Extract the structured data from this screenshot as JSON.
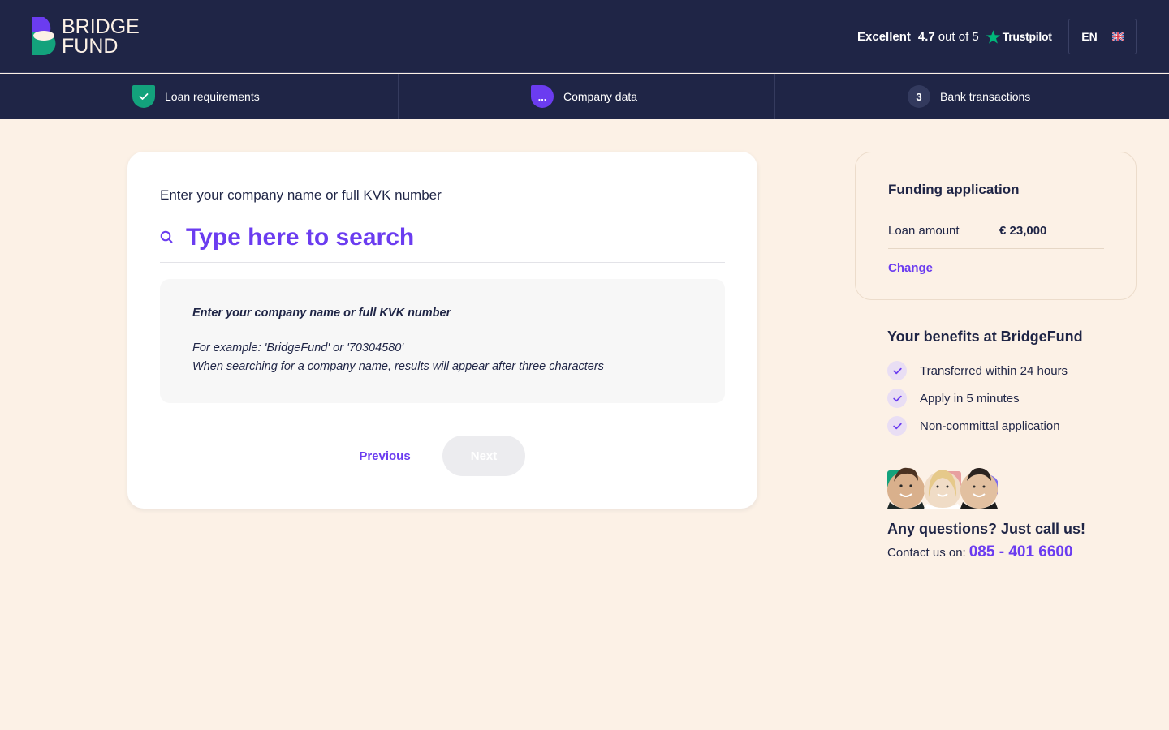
{
  "header": {
    "logo": {
      "line1": "BRIDGE",
      "line2": "FUND"
    },
    "trustpilot": {
      "rating_word": "Excellent",
      "score": "4.7",
      "out_of": "out of 5",
      "brand": "Trustpilot"
    },
    "language": {
      "code": "EN",
      "flag": "uk-flag-icon"
    }
  },
  "steps": [
    {
      "label": "Loan requirements",
      "state": "done",
      "badge": ""
    },
    {
      "label": "Company data",
      "state": "active",
      "badge": "..."
    },
    {
      "label": "Bank transactions",
      "state": "todo",
      "badge": "3"
    }
  ],
  "search": {
    "label": "Enter your company name or full KVK number",
    "placeholder": "Type here to search",
    "value": ""
  },
  "hint": {
    "title": "Enter your company name or full KVK number",
    "line1": "For example: 'BridgeFund' or '70304580'",
    "line2": "When searching for a company name, results will appear after three characters"
  },
  "actions": {
    "previous": "Previous",
    "next": "Next"
  },
  "funding": {
    "title": "Funding application",
    "loan_label": "Loan amount",
    "loan_value": "€ 23,000",
    "change": "Change"
  },
  "benefits": {
    "title": "Your benefits at BridgeFund",
    "items": [
      "Transferred within 24 hours",
      "Apply in 5 minutes",
      "Non-committal application"
    ]
  },
  "contact": {
    "title": "Any questions? Just call us!",
    "prefix": "Contact us on:",
    "phone": "085 - 401 6600"
  },
  "colors": {
    "navy": "#1f2546",
    "purple": "#6b3cf0",
    "green": "#13a27c",
    "cream": "#fcf1e6"
  }
}
